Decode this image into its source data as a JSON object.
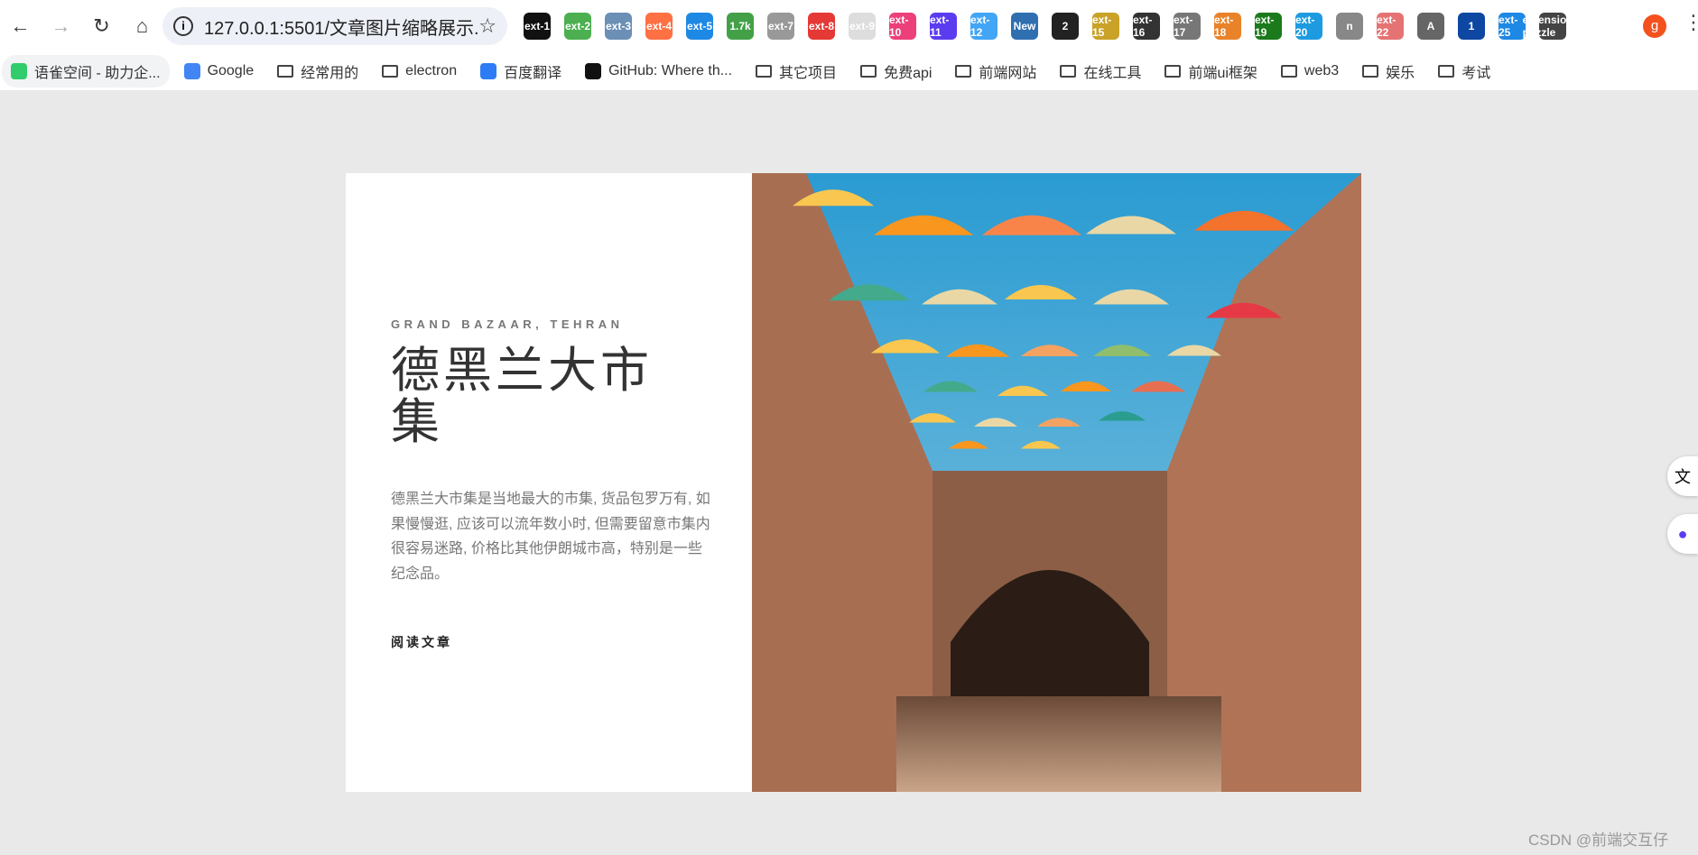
{
  "browser": {
    "url": "127.0.0.1:5501/文章图片缩略展示...",
    "extensions": [
      "ext-1",
      "ext-2",
      "ext-3",
      "ext-4",
      "ext-5",
      "1.7k",
      "ext-7",
      "ext-8",
      "ext-9",
      "ext-10",
      "ext-11",
      "ext-12",
      "New",
      "2",
      "ext-15",
      "ext-16",
      "ext-17",
      "ext-18",
      "ext-19",
      "ext-20",
      "n",
      "ext-22",
      "A",
      "1",
      "ext-25",
      "extensions-puzzle"
    ],
    "profile_initial": "g",
    "bookmarks": [
      {
        "label": "语雀空间 - 助力企...",
        "icon": "yuque-icon"
      },
      {
        "label": "Google",
        "icon": "google-icon"
      },
      {
        "label": "经常用的",
        "icon": "folder-icon"
      },
      {
        "label": "electron",
        "icon": "folder-icon"
      },
      {
        "label": "百度翻译",
        "icon": "translate-icon"
      },
      {
        "label": "GitHub: Where th...",
        "icon": "github-icon"
      },
      {
        "label": "其它项目",
        "icon": "folder-icon"
      },
      {
        "label": "免费api",
        "icon": "folder-icon"
      },
      {
        "label": "前端网站",
        "icon": "folder-icon"
      },
      {
        "label": "在线工具",
        "icon": "folder-icon"
      },
      {
        "label": "前端ui框架",
        "icon": "folder-icon"
      },
      {
        "label": "web3",
        "icon": "folder-icon"
      },
      {
        "label": "娱乐",
        "icon": "folder-icon"
      },
      {
        "label": "考试",
        "icon": "folder-icon"
      }
    ]
  },
  "article": {
    "kicker": "GRAND BAZAAR, TEHRAN",
    "title": "德黑兰大市集",
    "description": "德黑兰大市集是当地最大的市集, 货品包罗万有, 如果慢慢逛, 应该可以流年数小时, 但需要留意市集内很容易迷路, 价格比其他伊朗城市高，特别是一些纪念品。",
    "read_label": "阅读文章",
    "prev_icon": "←",
    "next_icon": "→"
  },
  "watermark": "CSDN @前端交互仔"
}
